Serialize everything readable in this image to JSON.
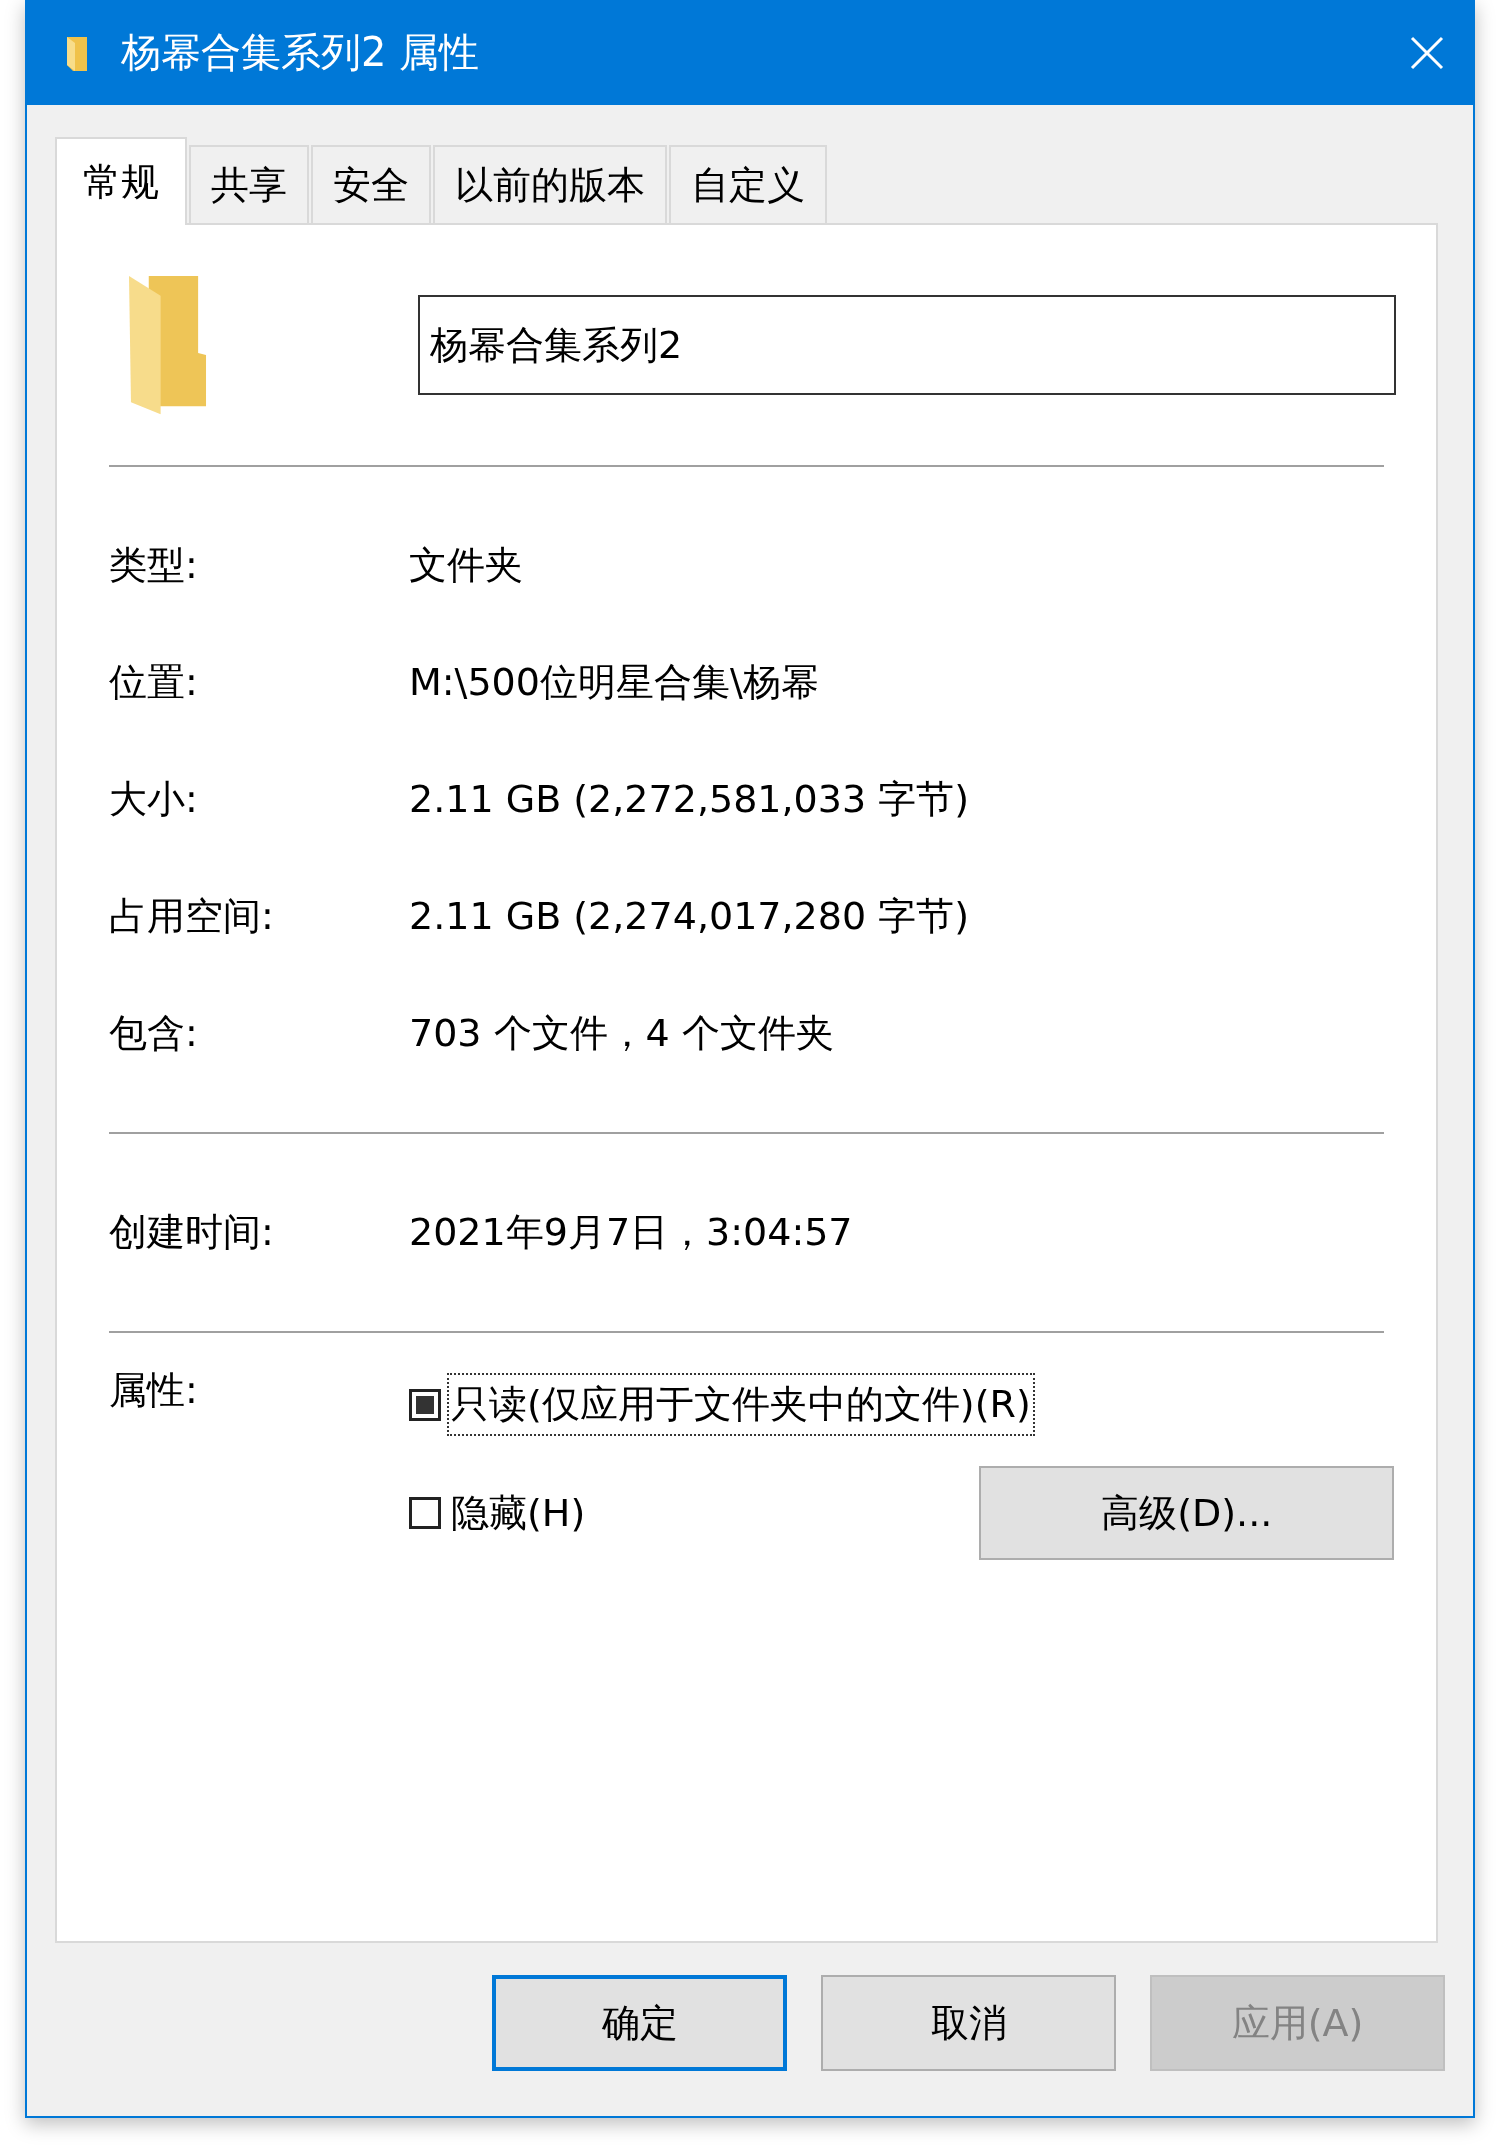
{
  "window": {
    "title": "杨幂合集系列2 属性"
  },
  "tabs": [
    {
      "label": "常规",
      "selected": true
    },
    {
      "label": "共享",
      "selected": false
    },
    {
      "label": "安全",
      "selected": false
    },
    {
      "label": "以前的版本",
      "selected": false
    },
    {
      "label": "自定义",
      "selected": false
    }
  ],
  "name_field": {
    "value": "杨幂合集系列2"
  },
  "info_groups": [
    [
      {
        "label": "类型:",
        "value": "文件夹"
      },
      {
        "label": "位置:",
        "value": "M:\\500位明星合集\\杨幂"
      },
      {
        "label": "大小:",
        "value": "2.11 GB (2,272,581,033 字节)"
      },
      {
        "label": "占用空间:",
        "value": "2.11 GB (2,274,017,280 字节)"
      },
      {
        "label": "包含:",
        "value": "703 个文件，4 个文件夹"
      }
    ],
    [
      {
        "label": "创建时间:",
        "value": "2021年9月7日，3:04:57"
      }
    ]
  ],
  "attributes": {
    "label": "属性:",
    "items": [
      {
        "label": "只读(仅应用于文件夹中的文件)(R)",
        "checked": false,
        "indeterminate": true,
        "focused": true
      },
      {
        "label": "隐藏(H)",
        "checked": false,
        "indeterminate": false,
        "focused": false
      }
    ],
    "advanced_button": "高级(D)..."
  },
  "buttons": [
    {
      "label": "确定",
      "default": true,
      "disabled": false
    },
    {
      "label": "取消",
      "default": false,
      "disabled": false
    },
    {
      "label": "应用(A)",
      "default": false,
      "disabled": true
    }
  ]
}
